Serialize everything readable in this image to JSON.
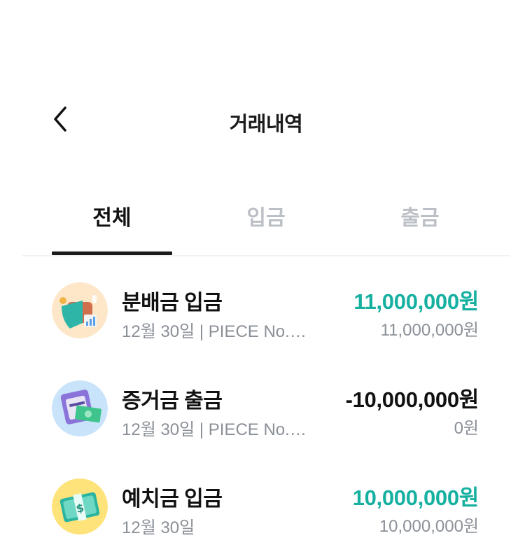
{
  "header": {
    "back_icon": "chevron-left-icon",
    "title": "거래내역"
  },
  "tabs": [
    {
      "label": "전체",
      "active": true
    },
    {
      "label": "입금",
      "active": false
    },
    {
      "label": "출금",
      "active": false
    }
  ],
  "transactions": [
    {
      "title": "분배금 입금",
      "subtitle": "12월 30일 | PIECE No.2…",
      "amount": "11,000,000원",
      "balance": "11,000,000원",
      "type": "deposit",
      "icon": "wallet-with-chart-icon",
      "icon_bg": "#fde7c8"
    },
    {
      "title": "증거금 출금",
      "subtitle": "12월 30일 | PIECE No.2…",
      "amount": "-10,000,000원",
      "balance": "0원",
      "type": "withdrawal",
      "icon": "atm-cash-withdraw-icon",
      "icon_bg": "#c9e3fb"
    },
    {
      "title": "예치금 입금",
      "subtitle": "12월 30일",
      "amount": "10,000,000원",
      "balance": "10,000,000원",
      "type": "deposit",
      "icon": "money-stack-icon",
      "icon_bg": "#fde37a"
    }
  ],
  "colors": {
    "deposit": "#16b0a0",
    "withdrawal": "#111111",
    "muted": "#8b9097",
    "tab_inactive": "#bcc0c6"
  }
}
